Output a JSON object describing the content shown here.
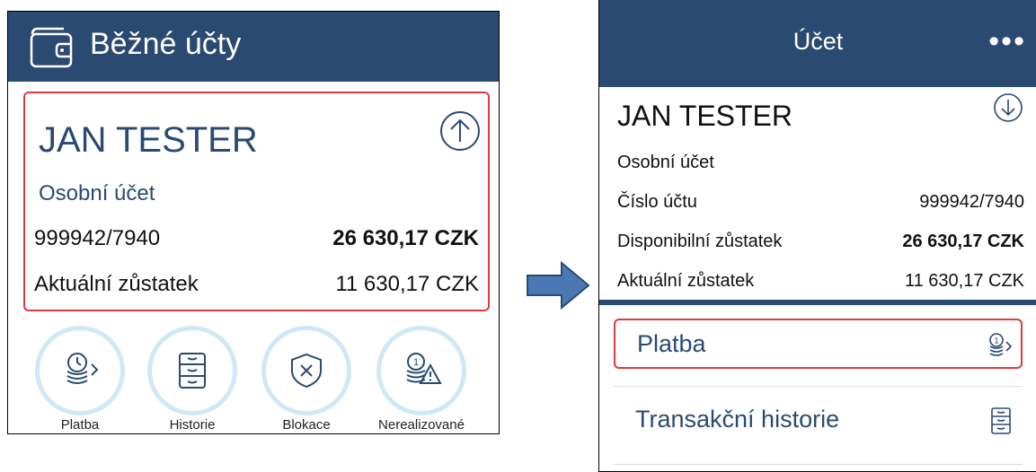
{
  "left": {
    "header_title": "Běžné účty",
    "account": {
      "name": "JAN TESTER",
      "type": "Osobní účet",
      "number": "999942/7940",
      "available_balance": "26 630,17 CZK",
      "current_label": "Aktuální zůstatek",
      "current_balance": "11 630,17 CZK"
    },
    "actions": [
      {
        "label": "Platba"
      },
      {
        "label": "Historie"
      },
      {
        "label": "Blokace"
      },
      {
        "label": "Nerealizované"
      }
    ]
  },
  "right": {
    "header_title": "Účet",
    "menu_dots": "•••",
    "account": {
      "name": "JAN TESTER",
      "type": "Osobní účet",
      "number_label": "Číslo účtu",
      "number": "999942/7940",
      "available_label": "Disponibilní zůstatek",
      "available_balance": "26 630,17 CZK",
      "current_label": "Aktuální zůstatek",
      "current_balance": "11 630,17 CZK"
    },
    "menu": [
      {
        "label": "Platba"
      },
      {
        "label": "Transakční historie"
      }
    ]
  },
  "colors": {
    "header": "#2a4a72",
    "highlight": "#e0393e",
    "ring": "#cfe8f7",
    "arrow": "#4a78b5"
  }
}
